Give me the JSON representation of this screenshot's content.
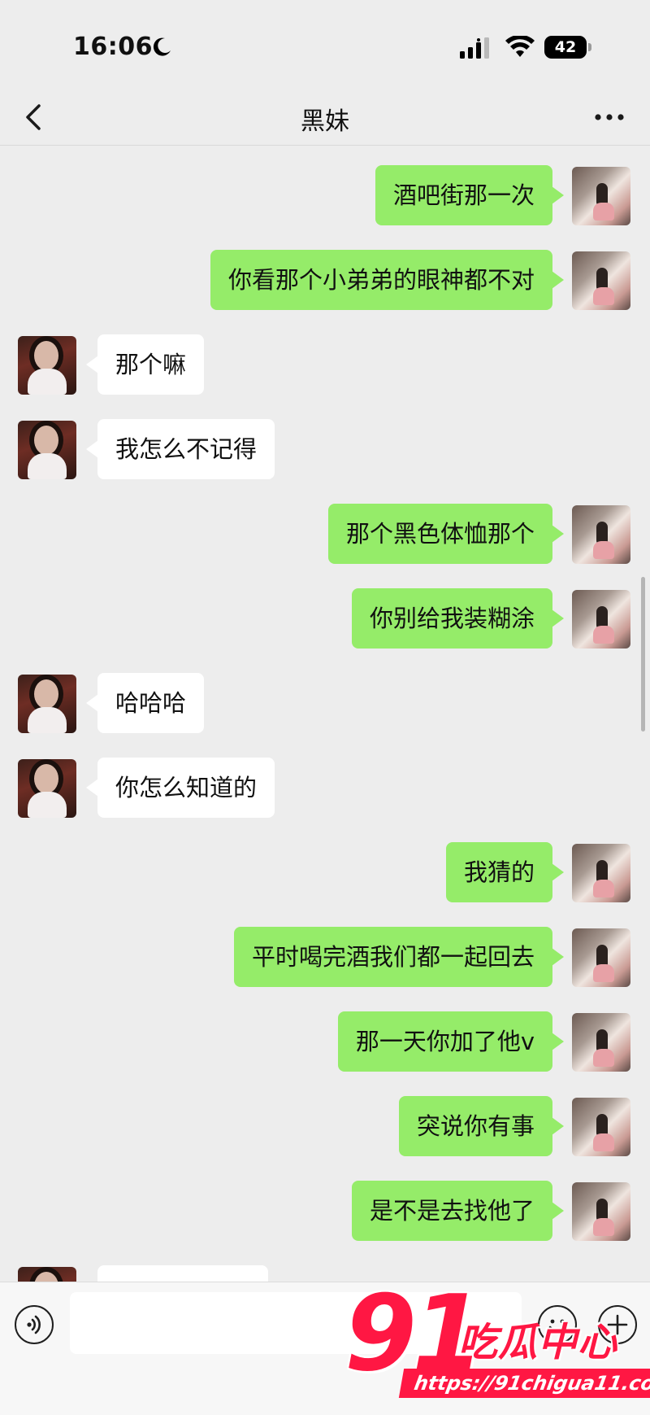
{
  "status_bar": {
    "time": "16:06",
    "battery": "42",
    "icons": [
      "moon-icon",
      "signal-icon",
      "wifi-icon",
      "battery-icon"
    ]
  },
  "nav": {
    "title": "黑妹",
    "back_icon": "chevron-left-icon",
    "more_icon": "more-dots-icon"
  },
  "messages": [
    {
      "sender": "me",
      "text": "酒吧街那一次"
    },
    {
      "sender": "me",
      "text": "你看那个小弟弟的眼神都不对"
    },
    {
      "sender": "them",
      "text": "那个嘛"
    },
    {
      "sender": "them",
      "text": "我怎么不记得"
    },
    {
      "sender": "me",
      "text": "那个黑色体恤那个"
    },
    {
      "sender": "me",
      "text": "你别给我装糊涂"
    },
    {
      "sender": "them",
      "text": "哈哈哈"
    },
    {
      "sender": "them",
      "text": "你怎么知道的"
    },
    {
      "sender": "me",
      "text": "我猜的"
    },
    {
      "sender": "me",
      "text": "平时喝完酒我们都一起回去"
    },
    {
      "sender": "me",
      "text": "那一天你加了他v"
    },
    {
      "sender": "me",
      "text": "突说你有事"
    },
    {
      "sender": "me",
      "text": "是不是去找他了"
    },
    {
      "sender": "them",
      "text": ""
    }
  ],
  "input_bar": {
    "placeholder": "",
    "value": "",
    "icons": [
      "voice-icon",
      "emoji-icon",
      "add-icon"
    ]
  },
  "watermark": {
    "number": "91",
    "brand": "吃瓜中心",
    "url": "https://91chigua11.com",
    "color": "#ff1743"
  },
  "colors": {
    "my_bubble": "#95ec69",
    "their_bubble": "#ffffff",
    "background": "#ededed"
  }
}
